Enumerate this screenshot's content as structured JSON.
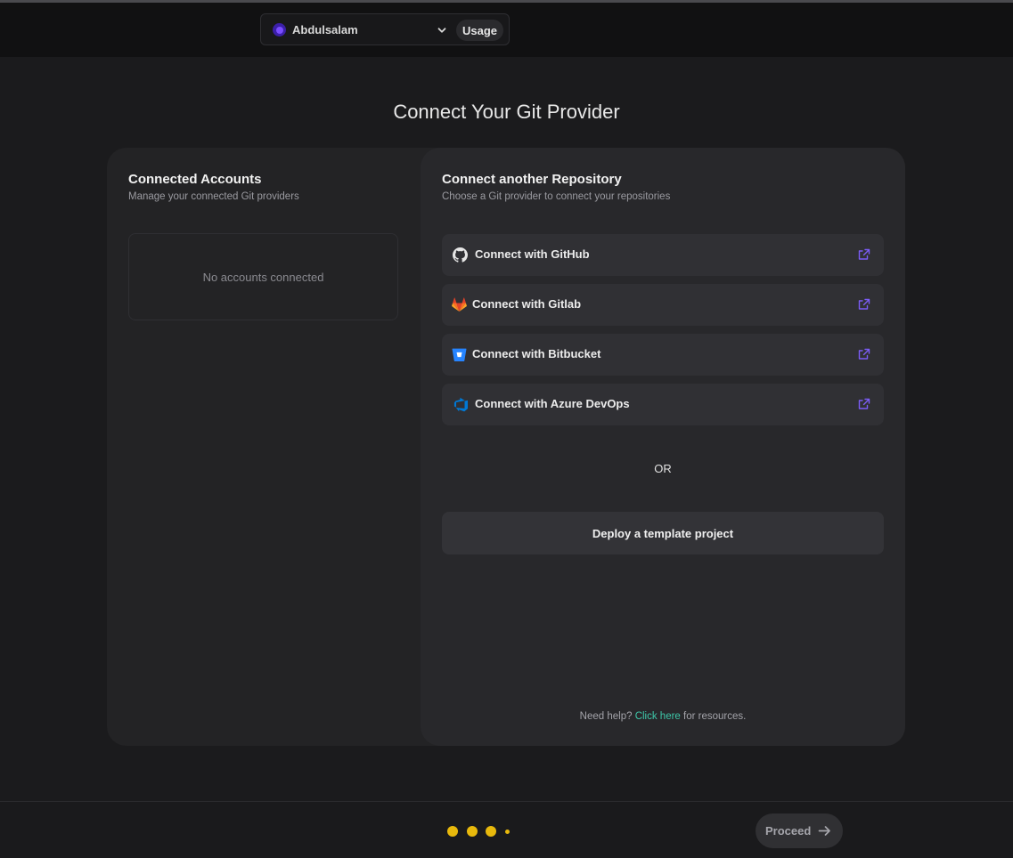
{
  "header": {
    "account_name": "Abdulsalam",
    "usage_label": "Usage"
  },
  "page": {
    "title": "Connect Your Git Provider"
  },
  "connected_accounts": {
    "title": "Connected Accounts",
    "subtitle": "Manage your connected Git providers",
    "empty_text": "No accounts connected"
  },
  "connect_repo": {
    "title": "Connect another Repository",
    "subtitle": "Choose a Git provider to connect your repositories",
    "providers": [
      {
        "label": "Connect with GitHub",
        "icon": "github-icon"
      },
      {
        "label": "Connect with Gitlab",
        "icon": "gitlab-icon"
      },
      {
        "label": "Connect with Bitbucket",
        "icon": "bitbucket-icon"
      },
      {
        "label": "Connect with Azure DevOps",
        "icon": "azure-devops-icon"
      }
    ],
    "or_text": "OR",
    "deploy_label": "Deploy a template project",
    "help_prefix": "Need help?",
    "help_link": "Click here",
    "help_suffix": "for resources."
  },
  "footer": {
    "proceed_label": "Proceed",
    "step_color": "#e8b90c"
  },
  "colors": {
    "background": "#1b1b1d",
    "card": "#232325",
    "accent_link": "#3ec7a9",
    "external_icon": "#7b5cf5"
  }
}
